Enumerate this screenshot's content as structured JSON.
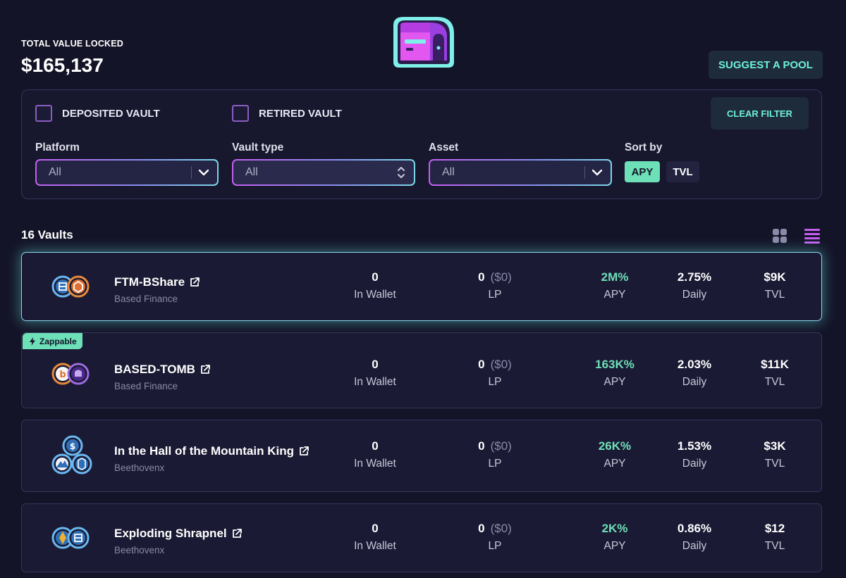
{
  "header": {
    "tvl_label": "TOTAL VALUE LOCKED",
    "tvl_value": "$165,137",
    "suggest_label": "SUGGEST A POOL"
  },
  "filters": {
    "deposited_label": "DEPOSITED VAULT",
    "retired_label": "RETIRED VAULT",
    "clear_label": "CLEAR FILTER",
    "platform_label": "Platform",
    "platform_value": "All",
    "vault_type_label": "Vault type",
    "vault_type_value": "All",
    "asset_label": "Asset",
    "asset_value": "All",
    "sort_label": "Sort by",
    "sort_apy": "APY",
    "sort_tvl": "TVL"
  },
  "list": {
    "count": "16 Vaults"
  },
  "colors": {
    "accent_teal": "#6ee0b8",
    "accent_purple": "#c45ff0",
    "background": "#141428",
    "card": "#1a1a34"
  },
  "vaults": [
    {
      "name": "FTM-BShare",
      "platform": "Based Finance",
      "wallet": "0",
      "wallet_label": "In Wallet",
      "lp": "0",
      "lp_usd": "($0)",
      "lp_label": "LP",
      "apy": "2M%",
      "apy_label": "APY",
      "daily": "2.75%",
      "daily_label": "Daily",
      "tvl": "$9K",
      "tvl_label": "TVL",
      "badge": ""
    },
    {
      "name": "BASED-TOMB",
      "platform": "Based Finance",
      "wallet": "0",
      "wallet_label": "In Wallet",
      "lp": "0",
      "lp_usd": "($0)",
      "lp_label": "LP",
      "apy": "163K%",
      "apy_label": "APY",
      "daily": "2.03%",
      "daily_label": "Daily",
      "tvl": "$11K",
      "tvl_label": "TVL",
      "badge": "Zappable"
    },
    {
      "name": "In the Hall of the Mountain King",
      "platform": "Beethovenx",
      "wallet": "0",
      "wallet_label": "In Wallet",
      "lp": "0",
      "lp_usd": "($0)",
      "lp_label": "LP",
      "apy": "26K%",
      "apy_label": "APY",
      "daily": "1.53%",
      "daily_label": "Daily",
      "tvl": "$3K",
      "tvl_label": "TVL",
      "badge": ""
    },
    {
      "name": "Exploding Shrapnel",
      "platform": "Beethovenx",
      "wallet": "0",
      "wallet_label": "In Wallet",
      "lp": "0",
      "lp_usd": "($0)",
      "lp_label": "LP",
      "apy": "2K%",
      "apy_label": "APY",
      "daily": "0.86%",
      "daily_label": "Daily",
      "tvl": "$12",
      "tvl_label": "TVL",
      "badge": ""
    }
  ]
}
